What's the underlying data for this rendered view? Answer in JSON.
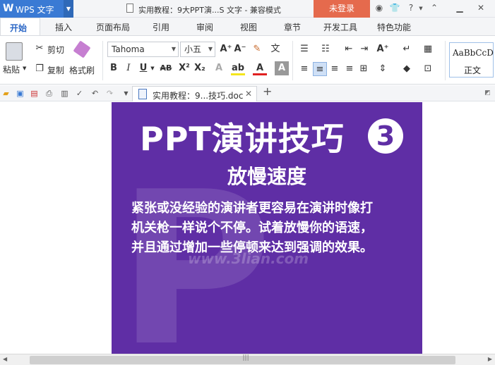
{
  "titlebar": {
    "app_logo": "W",
    "app_name": "WPS 文字",
    "doc_title": "实用教程：9大PPT演...S 文字 - 兼容模式",
    "login": "未登录",
    "help": "?"
  },
  "tabs": [
    "开始",
    "插入",
    "页面布局",
    "引用",
    "审阅",
    "视图",
    "章节",
    "开发工具",
    "特色功能"
  ],
  "ribbon": {
    "paste": "粘贴",
    "cut": "剪切",
    "copy": "复制",
    "format_painter": "格式刷",
    "font_family": "Tahoma",
    "font_size": "小五",
    "style_sample": "AaBbCcD",
    "style_name": "正文"
  },
  "quickbar": {
    "doc_tab": "实用教程：9...技巧.doc"
  },
  "slide": {
    "title": "PPT演讲技巧",
    "number": "3",
    "subtitle": "放慢速度",
    "body_lines": [
      "紧张或没经验的演讲者更容易在演讲时像打",
      "机关枪一样说个不停。试着放慢你的语速，",
      "并且通过增加一些停顿来达到强调的效果。"
    ],
    "watermark": "www.3lian.com"
  },
  "colors": {
    "wps_blue": "#3a7ad4",
    "login_red": "#e56a4d",
    "slide_purple": "#5f2ea5"
  }
}
